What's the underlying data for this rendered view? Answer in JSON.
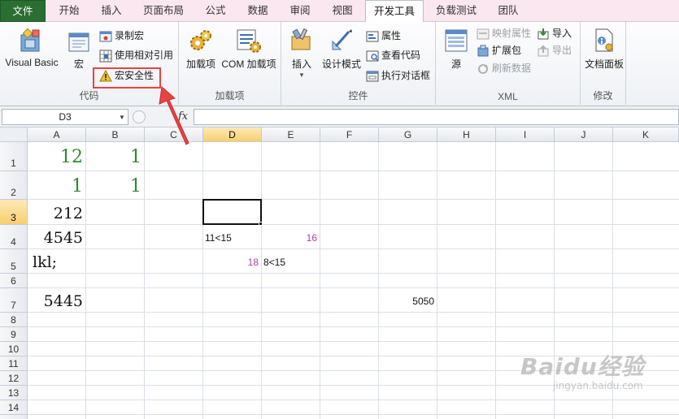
{
  "tabs": [
    "文件",
    "开始",
    "插入",
    "页面布局",
    "公式",
    "数据",
    "审阅",
    "视图",
    "开发工具",
    "负载测试",
    "团队"
  ],
  "active_tab": "开发工具",
  "ribbon": {
    "code": {
      "label": "代码",
      "visual_basic": "Visual Basic",
      "macros": "宏",
      "record_macro": "录制宏",
      "relative_refs": "使用相对引用",
      "macro_security": "宏安全性"
    },
    "addins": {
      "label": "加载项",
      "addins": "加载项",
      "com_addins": "COM 加载项"
    },
    "controls": {
      "label": "控件",
      "insert": "插入",
      "design_mode": "设计模式",
      "properties": "属性",
      "view_code": "查看代码",
      "run_dialog": "执行对话框"
    },
    "xml": {
      "label": "XML",
      "source": "源",
      "map_properties": "映射属性",
      "expansion_packs": "扩展包",
      "refresh_data": "刷新数据",
      "import": "导入",
      "export": "导出"
    },
    "modify": {
      "label": "修改",
      "document_panel": "文档面板"
    }
  },
  "formula_bar": {
    "name_box": "D3",
    "fx": "fx",
    "formula": ""
  },
  "columns": [
    "A",
    "B",
    "C",
    "D",
    "E",
    "F",
    "G",
    "H",
    "I",
    "J",
    "K"
  ],
  "selected_column": "D",
  "rows": [
    "1",
    "2",
    "3",
    "4",
    "5",
    "6",
    "7",
    "8",
    "9",
    "10",
    "11",
    "12",
    "13",
    "14"
  ],
  "selected_row": "3",
  "cells": {
    "A1": "12",
    "B1": "1",
    "A2": "1",
    "B2": "1",
    "A3": "212",
    "A4": "4545",
    "D4": "11<15",
    "E4": "16",
    "A5": "lkl;",
    "D5": "18",
    "E5": "8<15",
    "A7": "5445",
    "G7": "5050"
  },
  "colors": {
    "file_tab": "#2a6e32",
    "highlight": "#e84343",
    "green_number": "#2f8a2f",
    "magenta_number": "#b03cb0",
    "selected_header": "#f7cf6e"
  },
  "watermark": {
    "brand": "Baidu经验",
    "url": "jingyan.baidu.com"
  }
}
